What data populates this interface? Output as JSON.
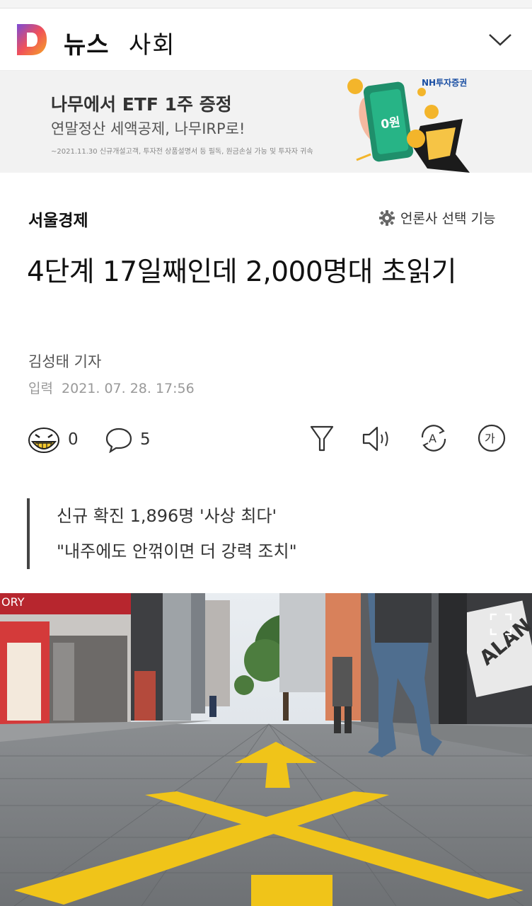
{
  "header": {
    "section": "뉴스",
    "category": "사회"
  },
  "banner": {
    "title": "나무에서 ETF 1주 증정",
    "subtitle": "연말정산 세액공제, 나무IRP로!",
    "fineprint": "~2021.11.30 신규개설고객, 투자전 상품설명서 등 필독, 원금손실 가능 및 투자자 귀속",
    "brand": "NH투자증권",
    "phone_label": "0원"
  },
  "article": {
    "press": "서울경제",
    "press_setting": "언론사 선택 기능",
    "headline": "4단계 17일째인데 2,000명대 초읽기",
    "reporter": "김성태 기자",
    "date_label": "입력",
    "date": "2021. 07. 28. 17:56",
    "summary": [
      "신규 확진 1,896명 '사상 최다'",
      "\"내주에도 안꺾이면 더 강력 조치\""
    ]
  },
  "actions": {
    "reaction_count": "0",
    "comment_count": "5",
    "font_icon_text": "가",
    "translate_icon_text": "A"
  },
  "photo": {
    "sign_text": "ALAN",
    "store_text": "ORY"
  },
  "colors": {
    "logo_orange": "#f5a623",
    "logo_purple": "#7b4bd6",
    "road_yellow": "#f0c419",
    "nh_blue": "#1a4fa3"
  }
}
